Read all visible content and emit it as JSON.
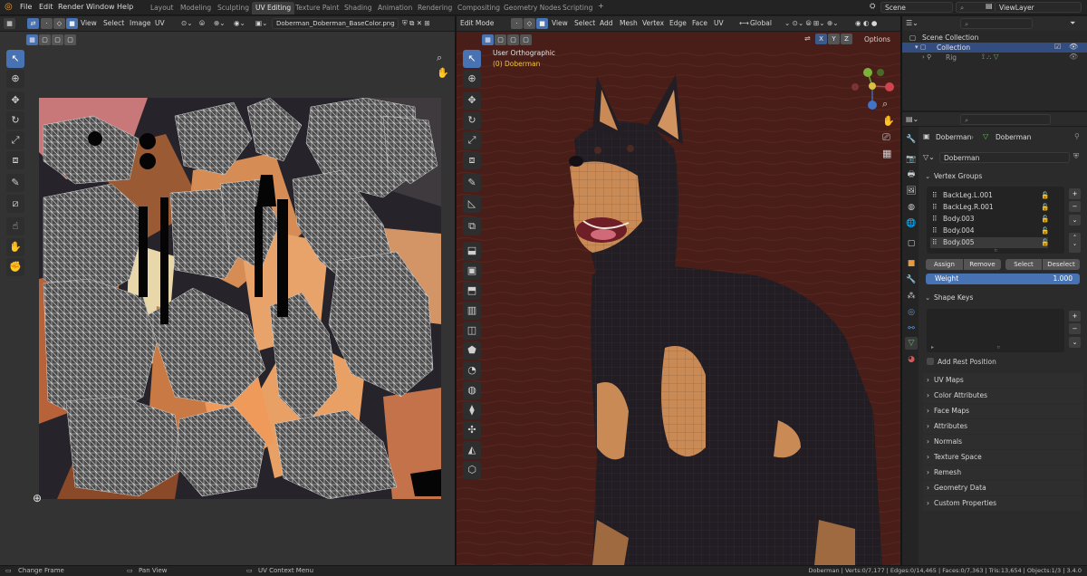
{
  "top": {
    "menus": [
      "File",
      "Edit",
      "Render",
      "Window",
      "Help"
    ],
    "tabs": [
      "Layout",
      "Modeling",
      "Sculpting",
      "UV Editing",
      "Texture Paint",
      "Shading",
      "Animation",
      "Rendering",
      "Compositing",
      "Geometry Nodes",
      "Scripting"
    ],
    "active_tab": "UV Editing",
    "scene": "Scene",
    "view_layer": "ViewLayer"
  },
  "uv_editor": {
    "menus": [
      "View",
      "Select",
      "Image",
      "UV"
    ],
    "image_name": "Doberman_Doberman_BaseColor.png"
  },
  "viewport": {
    "mode": "Edit Mode",
    "menus": [
      "View",
      "Select",
      "Add",
      "Mesh",
      "Vertex",
      "Edge",
      "Face",
      "UV"
    ],
    "orientation": "Global",
    "overlay_title": "User Orthographic",
    "overlay_object": "(0) Doberman",
    "options_label": "Options",
    "axes": [
      "X",
      "Y",
      "Z"
    ]
  },
  "outliner": {
    "scene_collection": "Scene Collection",
    "collection": "Collection",
    "rig": "Rig"
  },
  "properties": {
    "breadcrumb_a": "Doberman",
    "breadcrumb_b": "Doberman",
    "mesh_name": "Doberman",
    "vertex_groups_label": "Vertex Groups",
    "vertex_groups": [
      "BackLeg.L.001",
      "BackLeg.R.001",
      "Body.003",
      "Body.004",
      "Body.005"
    ],
    "buttons": [
      "Assign",
      "Remove",
      "Select",
      "Deselect"
    ],
    "weight_label": "Weight",
    "weight_value": "1.000",
    "shape_keys_label": "Shape Keys",
    "add_rest_position": "Add Rest Position",
    "panels": [
      "UV Maps",
      "Color Attributes",
      "Face Maps",
      "Attributes",
      "Normals",
      "Texture Space",
      "Remesh",
      "Geometry Data",
      "Custom Properties"
    ]
  },
  "status": {
    "change_frame": "Change Frame",
    "pan_view": "Pan View",
    "uv_context_menu": "UV Context Menu",
    "stats": "Doberman | Verts:0/7,177 | Edges:0/14,465 | Faces:0/7,363 | Tris:13,654 | Objects:1/3 | 3.4.0"
  }
}
